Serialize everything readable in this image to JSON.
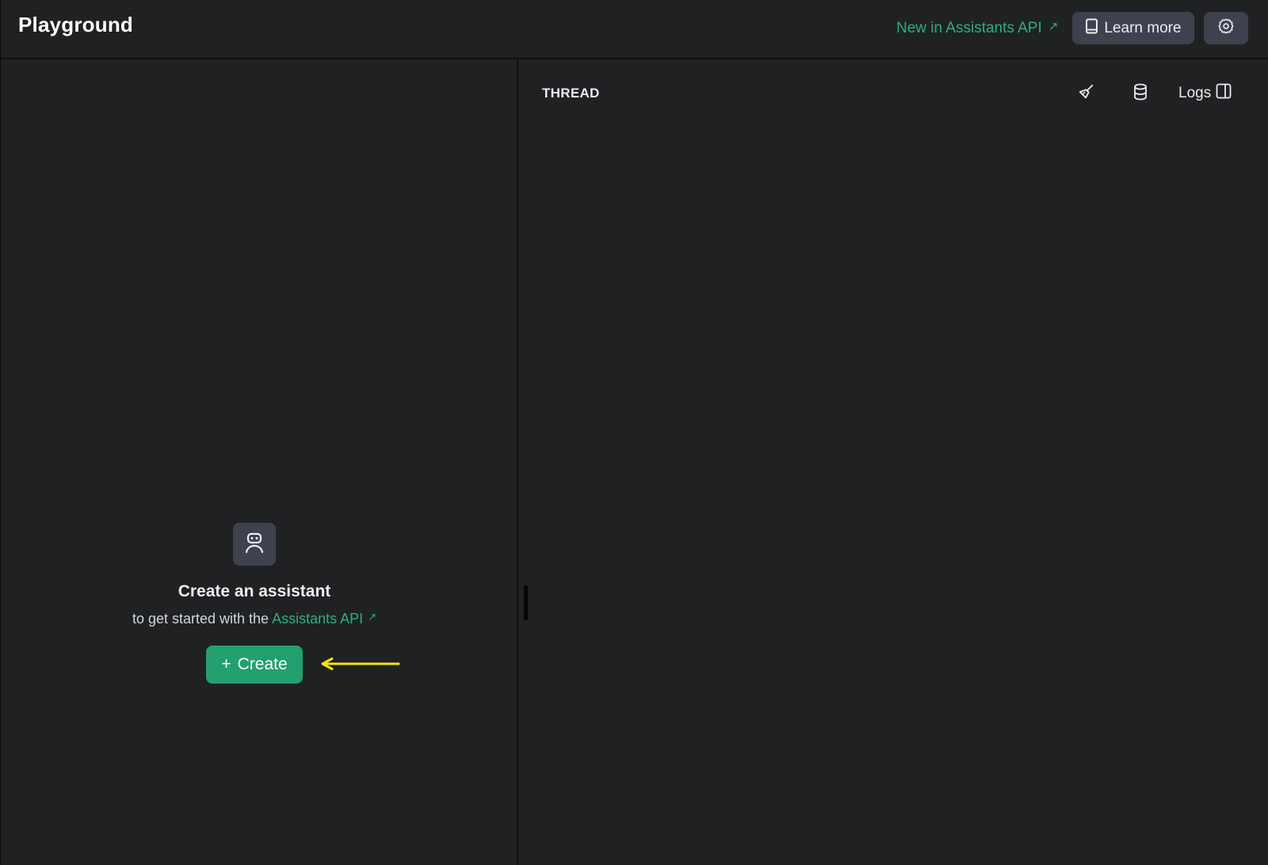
{
  "header": {
    "title": "Playground",
    "new_link": "New in Assistants API",
    "new_link_arrow": "↗",
    "learn_more": "Learn more"
  },
  "thread": {
    "label": "THREAD",
    "logs": "Logs"
  },
  "empty_state": {
    "title": "Create an assistant",
    "subtitle_prefix": "to get started with the",
    "api_link": "Assistants API",
    "api_link_arrow": "↗",
    "create_plus": "+",
    "create_label": "Create"
  },
  "colors": {
    "background": "#202123",
    "accent_green": "#23a06f",
    "link_green": "#2bb27a",
    "button_gray": "#40414f",
    "annotation_arrow": "#f5e11a"
  },
  "icons": [
    "book-icon",
    "gear-icon",
    "broom-icon",
    "database-icon",
    "panel-icon",
    "robot-icon",
    "external-link-icon"
  ]
}
